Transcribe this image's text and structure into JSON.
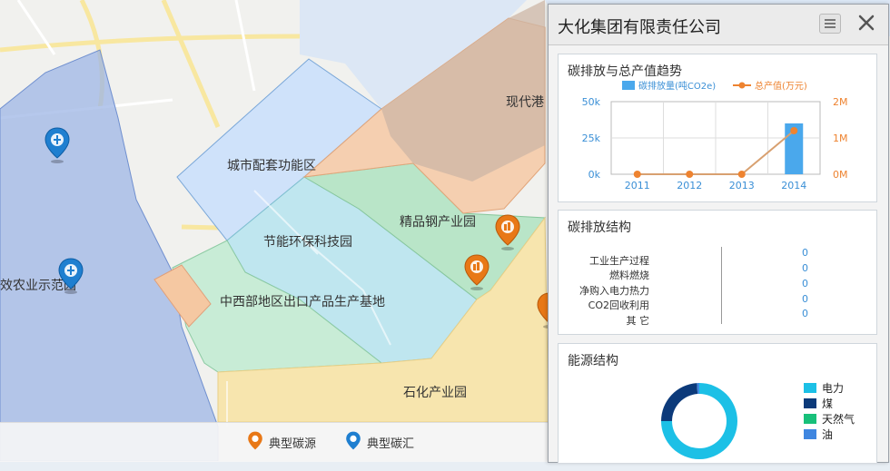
{
  "map": {
    "zones": [
      {
        "id": "city",
        "label": "城市配套功能区"
      },
      {
        "id": "energy",
        "label": "节能环保科技园"
      },
      {
        "id": "steel",
        "label": "精品钢产业园"
      },
      {
        "id": "export",
        "label": "中西部地区出口产品生产基地"
      },
      {
        "id": "petro",
        "label": "石化产业园"
      },
      {
        "id": "port",
        "label": "现代港"
      },
      {
        "id": "agri",
        "label": "效农业示范园"
      }
    ],
    "legend": {
      "source": "典型碳源",
      "sink": "典型碳汇"
    },
    "colors": {
      "source_pin": "#e87817",
      "sink_pin": "#1f7fd0"
    }
  },
  "panel": {
    "title": "大化集团有限责任公司",
    "trend": {
      "title": "碳排放与总产值趋势",
      "legend_bar": "碳排放量(吨CO2e)",
      "legend_line": "总产值(万元)",
      "left_ticks": [
        "50k",
        "25k",
        "0k"
      ],
      "right_ticks": [
        "2M",
        "1M",
        "0M"
      ]
    },
    "structure": {
      "title": "碳排放结构",
      "rows": [
        {
          "label": "工业生产过程",
          "value": "0"
        },
        {
          "label": "燃料燃烧",
          "value": "0"
        },
        {
          "label": "净购入电力热力",
          "value": "0"
        },
        {
          "label": "CO2回收利用",
          "value": "0"
        },
        {
          "label": "其 它",
          "value": "0"
        }
      ]
    },
    "energy": {
      "title": "能源结构",
      "legend": [
        {
          "label": "电力",
          "color": "#1cc0e6"
        },
        {
          "label": "煤",
          "color": "#0c3a7a"
        },
        {
          "label": "天然气",
          "color": "#18c07a"
        },
        {
          "label": "油",
          "color": "#3f86e0"
        }
      ],
      "shares": [
        0.75,
        0.24,
        0.0,
        0.01
      ]
    }
  },
  "chart_data": {
    "type": "bar",
    "title": "碳排放与总产值趋势",
    "categories": [
      "2011",
      "2012",
      "2013",
      "2014"
    ],
    "series": [
      {
        "name": "碳排放量(吨CO2e)",
        "type": "bar",
        "axis": "left",
        "values": [
          0,
          0,
          0,
          35000
        ]
      },
      {
        "name": "总产值(万元)",
        "type": "line",
        "axis": "right",
        "values": [
          0,
          0,
          0,
          1200000
        ]
      }
    ],
    "ylim_left": [
      0,
      50000
    ],
    "ylim_right": [
      0,
      2000000
    ],
    "colors": {
      "bar": "#4aa8ec",
      "line": "#ee8330"
    }
  }
}
